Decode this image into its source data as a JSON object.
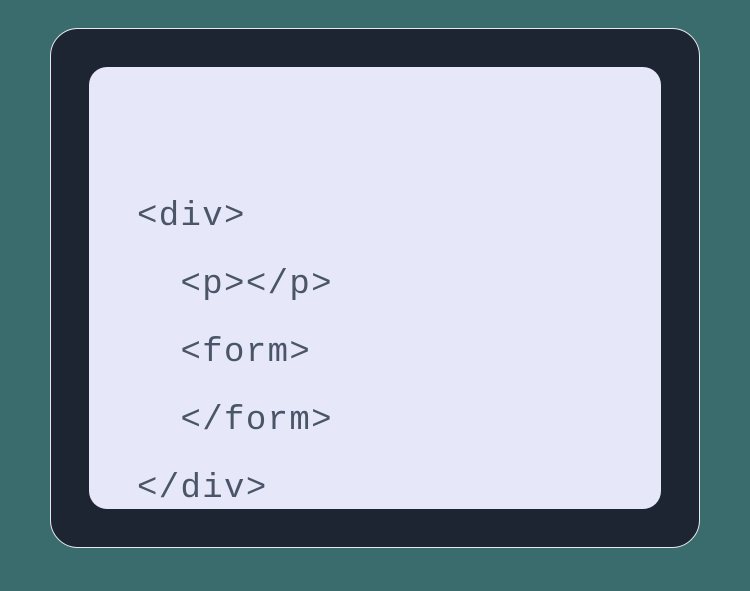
{
  "code": {
    "lines": [
      "<div>",
      "  <p></p>",
      "  <form>",
      "  </form>",
      "</div>"
    ]
  }
}
